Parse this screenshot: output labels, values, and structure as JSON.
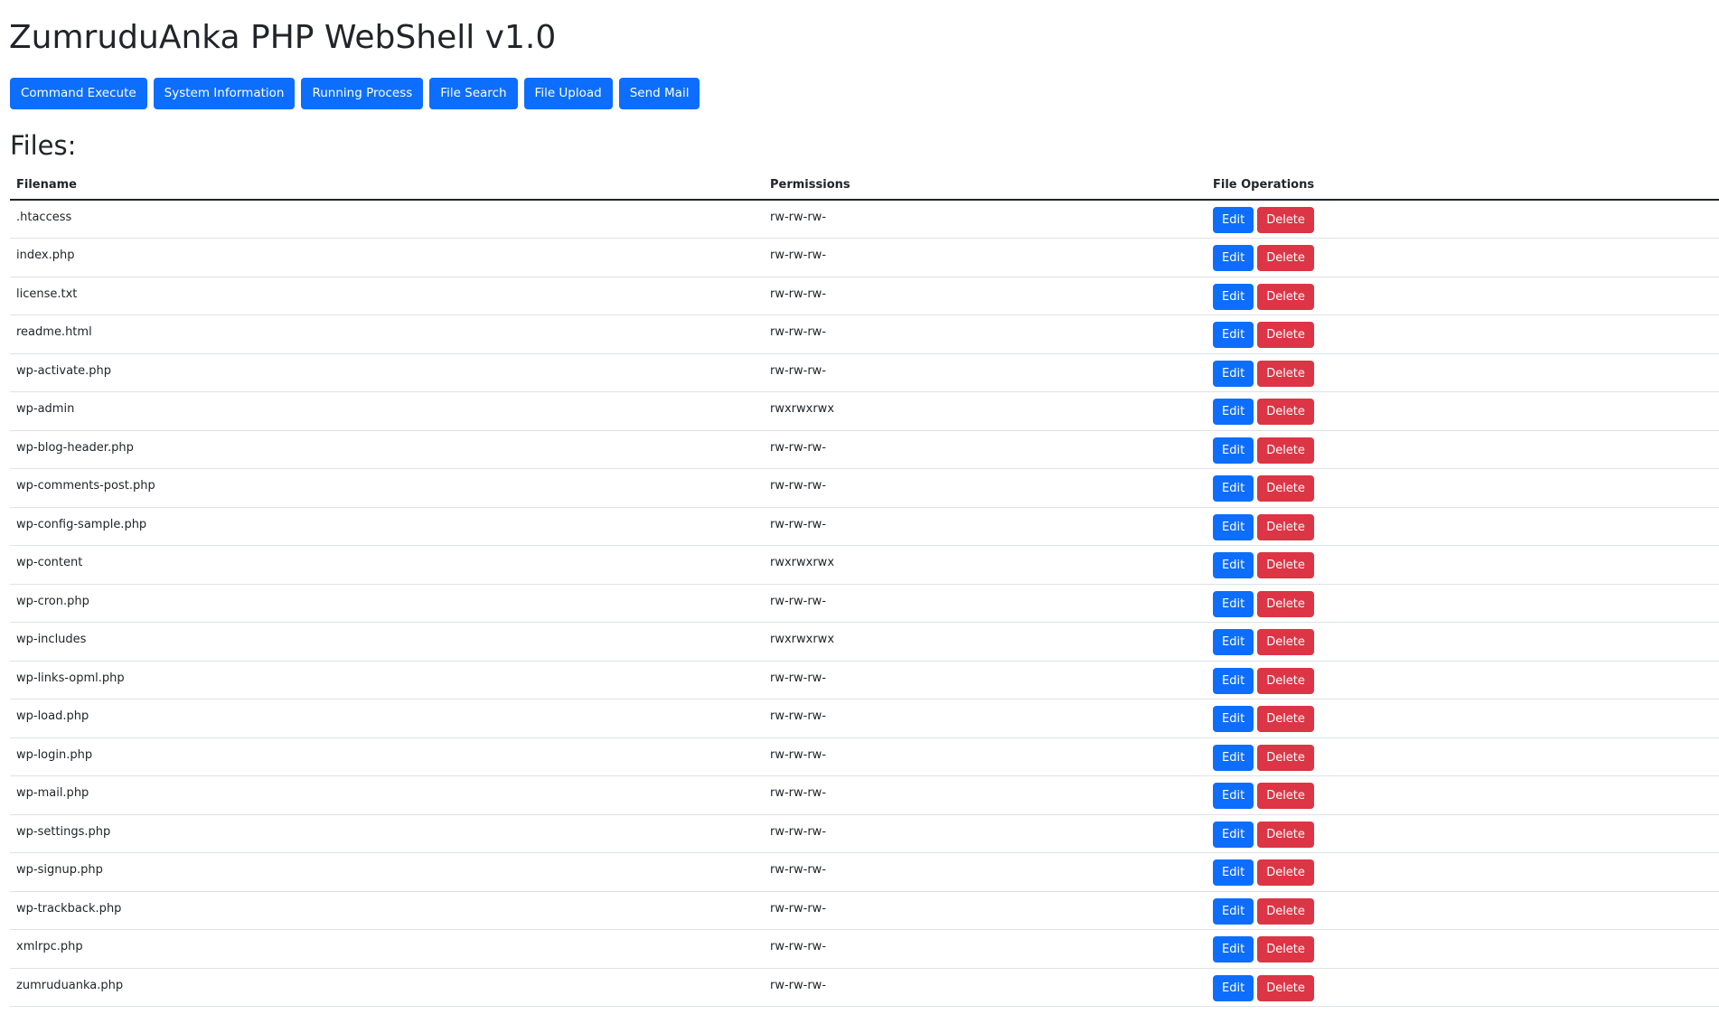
{
  "header": {
    "title": "ZumruduAnka PHP WebShell v1.0"
  },
  "nav": {
    "buttons": [
      {
        "label": "Command Execute"
      },
      {
        "label": "System Information"
      },
      {
        "label": "Running Process"
      },
      {
        "label": "File Search"
      },
      {
        "label": "File Upload"
      },
      {
        "label": "Send Mail"
      }
    ]
  },
  "files": {
    "heading": "Files:",
    "columns": {
      "filename": "Filename",
      "permissions": "Permissions",
      "operations": "File Operations"
    },
    "edit_label": "Edit",
    "delete_label": "Delete",
    "rows": [
      {
        "name": ".htaccess",
        "perm": "rw-rw-rw-"
      },
      {
        "name": "index.php",
        "perm": "rw-rw-rw-"
      },
      {
        "name": "license.txt",
        "perm": "rw-rw-rw-"
      },
      {
        "name": "readme.html",
        "perm": "rw-rw-rw-"
      },
      {
        "name": "wp-activate.php",
        "perm": "rw-rw-rw-"
      },
      {
        "name": "wp-admin",
        "perm": "rwxrwxrwx"
      },
      {
        "name": "wp-blog-header.php",
        "perm": "rw-rw-rw-"
      },
      {
        "name": "wp-comments-post.php",
        "perm": "rw-rw-rw-"
      },
      {
        "name": "wp-config-sample.php",
        "perm": "rw-rw-rw-"
      },
      {
        "name": "wp-content",
        "perm": "rwxrwxrwx"
      },
      {
        "name": "wp-cron.php",
        "perm": "rw-rw-rw-"
      },
      {
        "name": "wp-includes",
        "perm": "rwxrwxrwx"
      },
      {
        "name": "wp-links-opml.php",
        "perm": "rw-rw-rw-"
      },
      {
        "name": "wp-load.php",
        "perm": "rw-rw-rw-"
      },
      {
        "name": "wp-login.php",
        "perm": "rw-rw-rw-"
      },
      {
        "name": "wp-mail.php",
        "perm": "rw-rw-rw-"
      },
      {
        "name": "wp-settings.php",
        "perm": "rw-rw-rw-"
      },
      {
        "name": "wp-signup.php",
        "perm": "rw-rw-rw-"
      },
      {
        "name": "wp-trackback.php",
        "perm": "rw-rw-rw-"
      },
      {
        "name": "xmlrpc.php",
        "perm": "rw-rw-rw-"
      },
      {
        "name": "zumruduanka.php",
        "perm": "rw-rw-rw-"
      }
    ]
  }
}
